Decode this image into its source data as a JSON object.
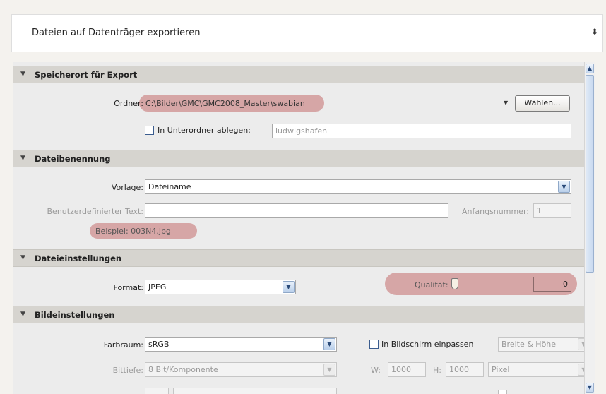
{
  "header": {
    "title": "Dateien auf Datenträger exportieren",
    "arrows": "⬍"
  },
  "sections": {
    "location": {
      "title": "Speicherort für Export",
      "folder_label": "Ordner:",
      "folder_path": "C:\\Bilder\\GMC\\GMC2008_Master\\swabian",
      "dropdown_arrow": "▼",
      "choose_button": "Wählen...",
      "subfolder_label": "In Unterordner ablegen:",
      "subfolder_value": "ludwigshafen"
    },
    "naming": {
      "title": "Dateibenennung",
      "template_label": "Vorlage:",
      "template_value": "Dateiname",
      "custom_text_label": "Benutzerdefinierter Text:",
      "custom_text_value": "",
      "start_number_label": "Anfangsnummer:",
      "start_number_value": "1",
      "example": "Beispiel: 003N4.jpg"
    },
    "file_settings": {
      "title": "Dateieinstellungen",
      "format_label": "Format:",
      "format_value": "JPEG",
      "quality_label": "Qualität:",
      "quality_value": "0",
      "quality_level": 0
    },
    "image_settings": {
      "title": "Bildeinstellungen",
      "colorspace_label": "Farbraum:",
      "colorspace_value": "sRGB",
      "fit_label": "In Bildschirm einpassen",
      "fit_mode_value": "Breite & Höhe",
      "bitdepth_label": "Bittiefe:",
      "bitdepth_value": "8 Bit/Komponente",
      "w_label": "W:",
      "w_value": "1000",
      "h_label": "H:",
      "h_value": "1000",
      "unit_value": "Pixel"
    }
  },
  "colors": {
    "highlight": "#c46e6e",
    "section_header": "#d6d4cf",
    "panel_bg": "#ececec",
    "accent_blue": "#3b5d8f"
  },
  "icons": {
    "section_toggle": "triangle-down-icon",
    "scroll_up": "scroll-up-icon",
    "scroll_down": "scroll-down-icon"
  }
}
